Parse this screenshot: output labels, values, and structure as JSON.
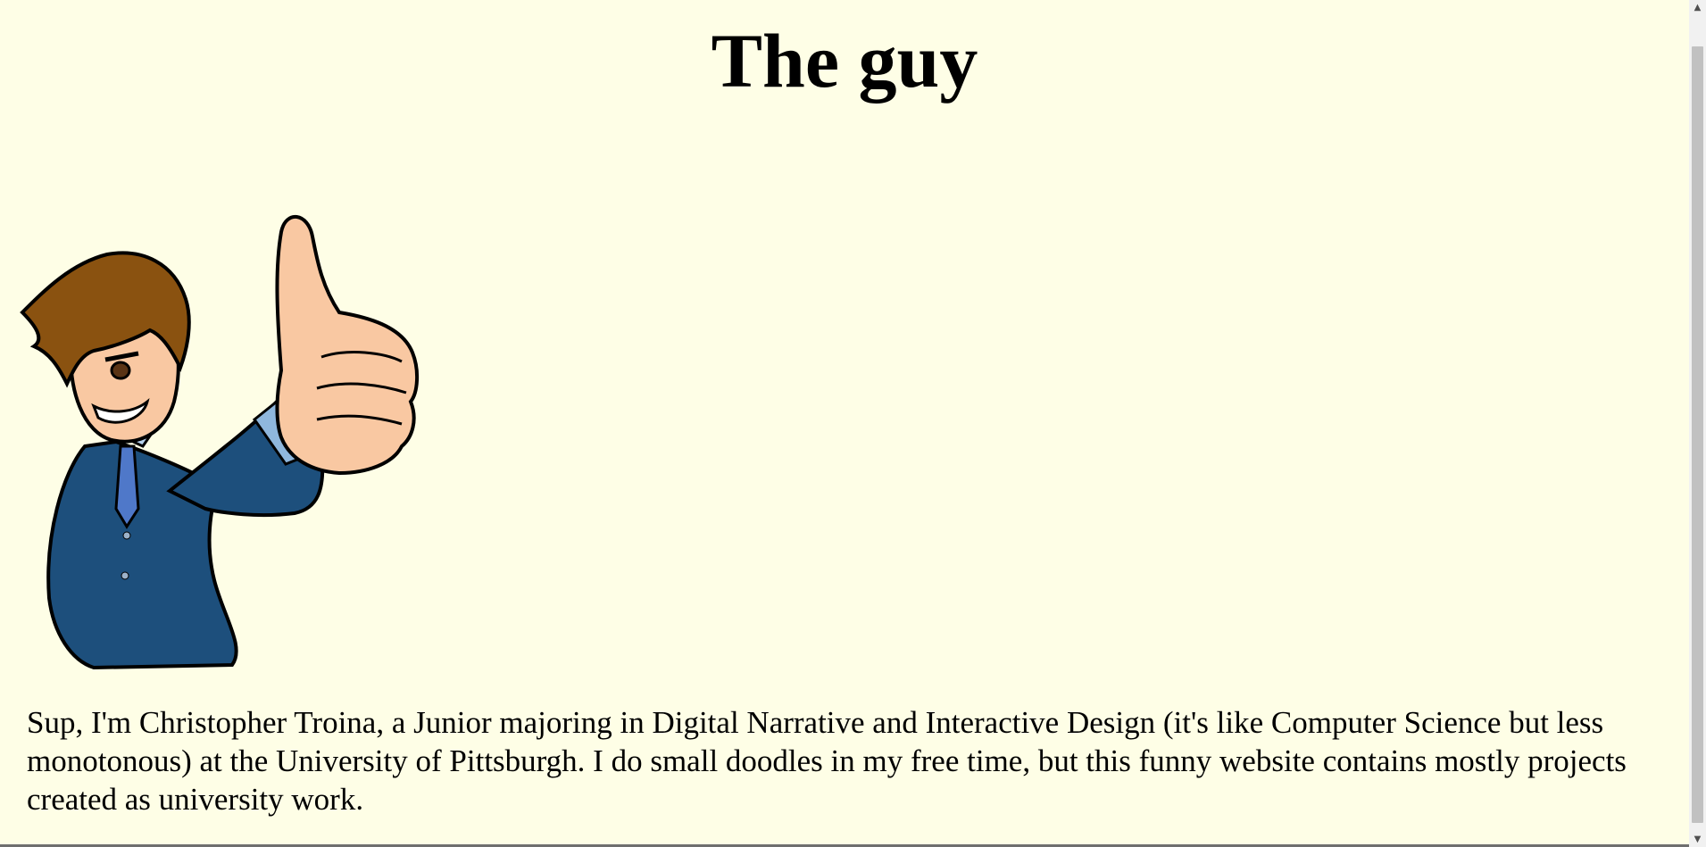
{
  "page": {
    "title": "The guy",
    "bio": "Sup, I'm Christopher Troina, a Junior majoring in Digital Narrative and Interactive Design (it's like Computer Science but less monotonous) at the University of Pittsburgh. I do small doodles in my free time, but this funny website contains mostly projects created as university work."
  },
  "colors": {
    "background": "#fefee6",
    "suit": "#1d4f7c",
    "hair": "#8a5210",
    "skin": "#f9c8a2"
  },
  "scrollbar": {
    "up_icon": "▲",
    "down_icon": "▼"
  }
}
